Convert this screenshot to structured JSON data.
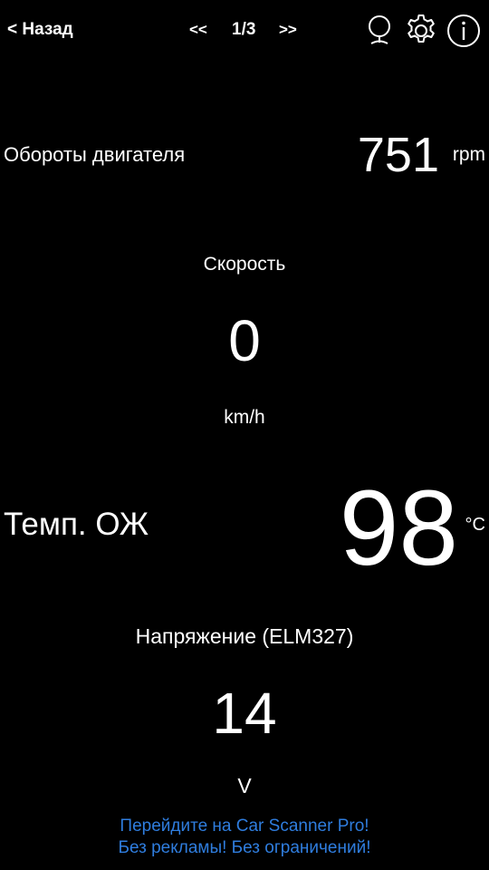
{
  "header": {
    "back_label": "< Назад",
    "prev_label": "<<",
    "page_indicator": "1/3",
    "next_label": ">>",
    "icons": [
      "microphone-icon",
      "gear-icon",
      "info-icon"
    ]
  },
  "gauges": {
    "rpm": {
      "label": "Обороты двигателя",
      "value": "751",
      "unit": "rpm"
    },
    "speed": {
      "label": "Скорость",
      "value": "0",
      "unit": "km/h"
    },
    "coolant_temp": {
      "label": "Темп. ОЖ",
      "value": "98",
      "unit": "°C"
    },
    "voltage": {
      "label": "Напряжение (ELM327)",
      "value": "14",
      "unit": "V"
    }
  },
  "promo": {
    "line1": "Перейдите на Car Scanner Pro!",
    "line2": "Без рекламы! Без ограничений!"
  },
  "colors": {
    "background": "#000000",
    "text": "#ffffff",
    "promo_link": "#2f7dde"
  }
}
